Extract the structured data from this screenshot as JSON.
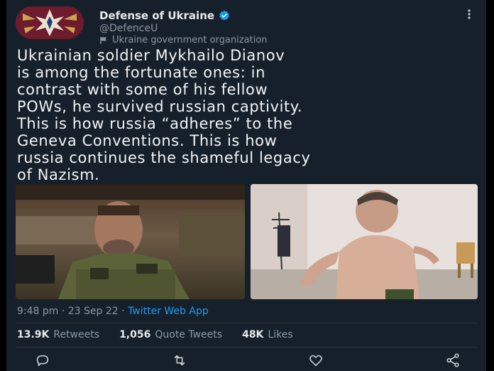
{
  "account": {
    "name": "Defense of Ukraine",
    "handle": "@DefenceU",
    "label": "Ukraine government organization"
  },
  "tweet": {
    "lines": [
      "Ukrainian soldier Mykhailo Dianov",
      "is among the fortunate ones: in",
      "contrast with some of his fellow",
      "POWs, he survived russian captivity.",
      "This is how russia “adheres” to the",
      "Geneva Conventions. This is how",
      "russia continues the shameful legacy",
      "of Nazism."
    ]
  },
  "meta": {
    "time": "9:48 pm",
    "date": "23 Sep 22",
    "separator": "·",
    "source": "Twitter Web App"
  },
  "stats": {
    "retweets_count": "13.9K",
    "retweets_label": "Retweets",
    "quotes_count": "1,056",
    "quotes_label": "Quote Tweets",
    "likes_count": "48K",
    "likes_label": "Likes"
  },
  "colors": {
    "background": "#15202b",
    "link": "#1d9bf0",
    "secondary_text": "#8b98a5",
    "avatar_bg": "#6e1b2e"
  },
  "icons": {
    "more": "more-vertical-icon",
    "verified": "verified-badge-icon",
    "flag": "flag-icon",
    "reply": "reply-icon",
    "retweet": "retweet-icon",
    "like": "heart-icon",
    "share": "share-icon"
  }
}
